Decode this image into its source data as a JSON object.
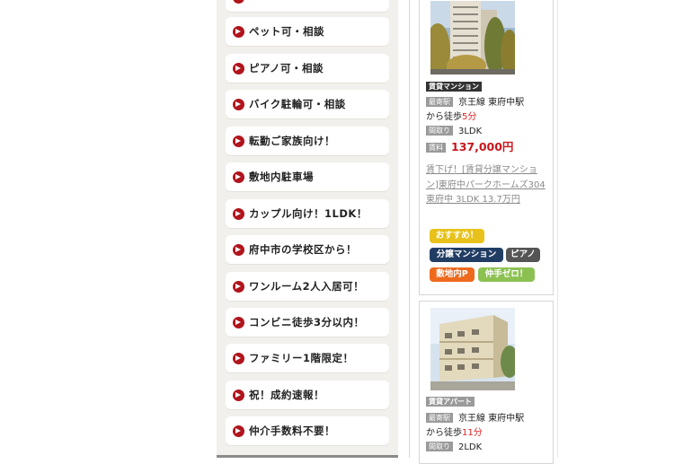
{
  "sidebar": {
    "items": [
      {
        "label": ""
      },
      {
        "label": "ペット可・相談"
      },
      {
        "label": "ピアノ可・相談"
      },
      {
        "label": "バイク駐輪可・相談"
      },
      {
        "label": "転勤ご家族向け！"
      },
      {
        "label": "敷地内駐車場"
      },
      {
        "label": "カップル向け！1LDK！"
      },
      {
        "label": "府中市の学校区から！"
      },
      {
        "label": "ワンルーム2人入居可！"
      },
      {
        "label": "コンビニ徒歩3分以内！"
      },
      {
        "label": "ファミリー1階限定！"
      },
      {
        "label": "祝！成約速報！"
      },
      {
        "label": "仲介手数料不要！"
      }
    ]
  },
  "listings": [
    {
      "type": "賃貸マンション",
      "station_tag": "最寄駅",
      "station": "京王線 東府中駅",
      "walk_prefix": "から徒歩",
      "walk_minutes": "5分",
      "layout_tag": "間取り",
      "layout": "3LDK",
      "rent_tag": "賃料",
      "price": "137,000円",
      "description": "賃下げ！[賃貸分譲マンション]東府中パークホームズ304 東府中 3LDK 13.7万円",
      "tags": [
        "おすすめ！",
        "分譲マンション",
        "ピアノ",
        "敷地内P",
        "仲手ゼロ！"
      ]
    },
    {
      "type": "賃貸アパート",
      "station_tag": "最寄駅",
      "station": "京王線 東府中駅",
      "walk_prefix": "から徒歩",
      "walk_minutes": "11分",
      "layout_tag": "間取り",
      "layout": "2LDK"
    }
  ],
  "colors": {
    "accent_red": "#c8161d",
    "tag_recommend": "#e8c21a",
    "tag_bunjo": "#213d64",
    "tag_piano": "#555555",
    "tag_parking": "#ee6a1f",
    "tag_zero": "#8cc152"
  }
}
